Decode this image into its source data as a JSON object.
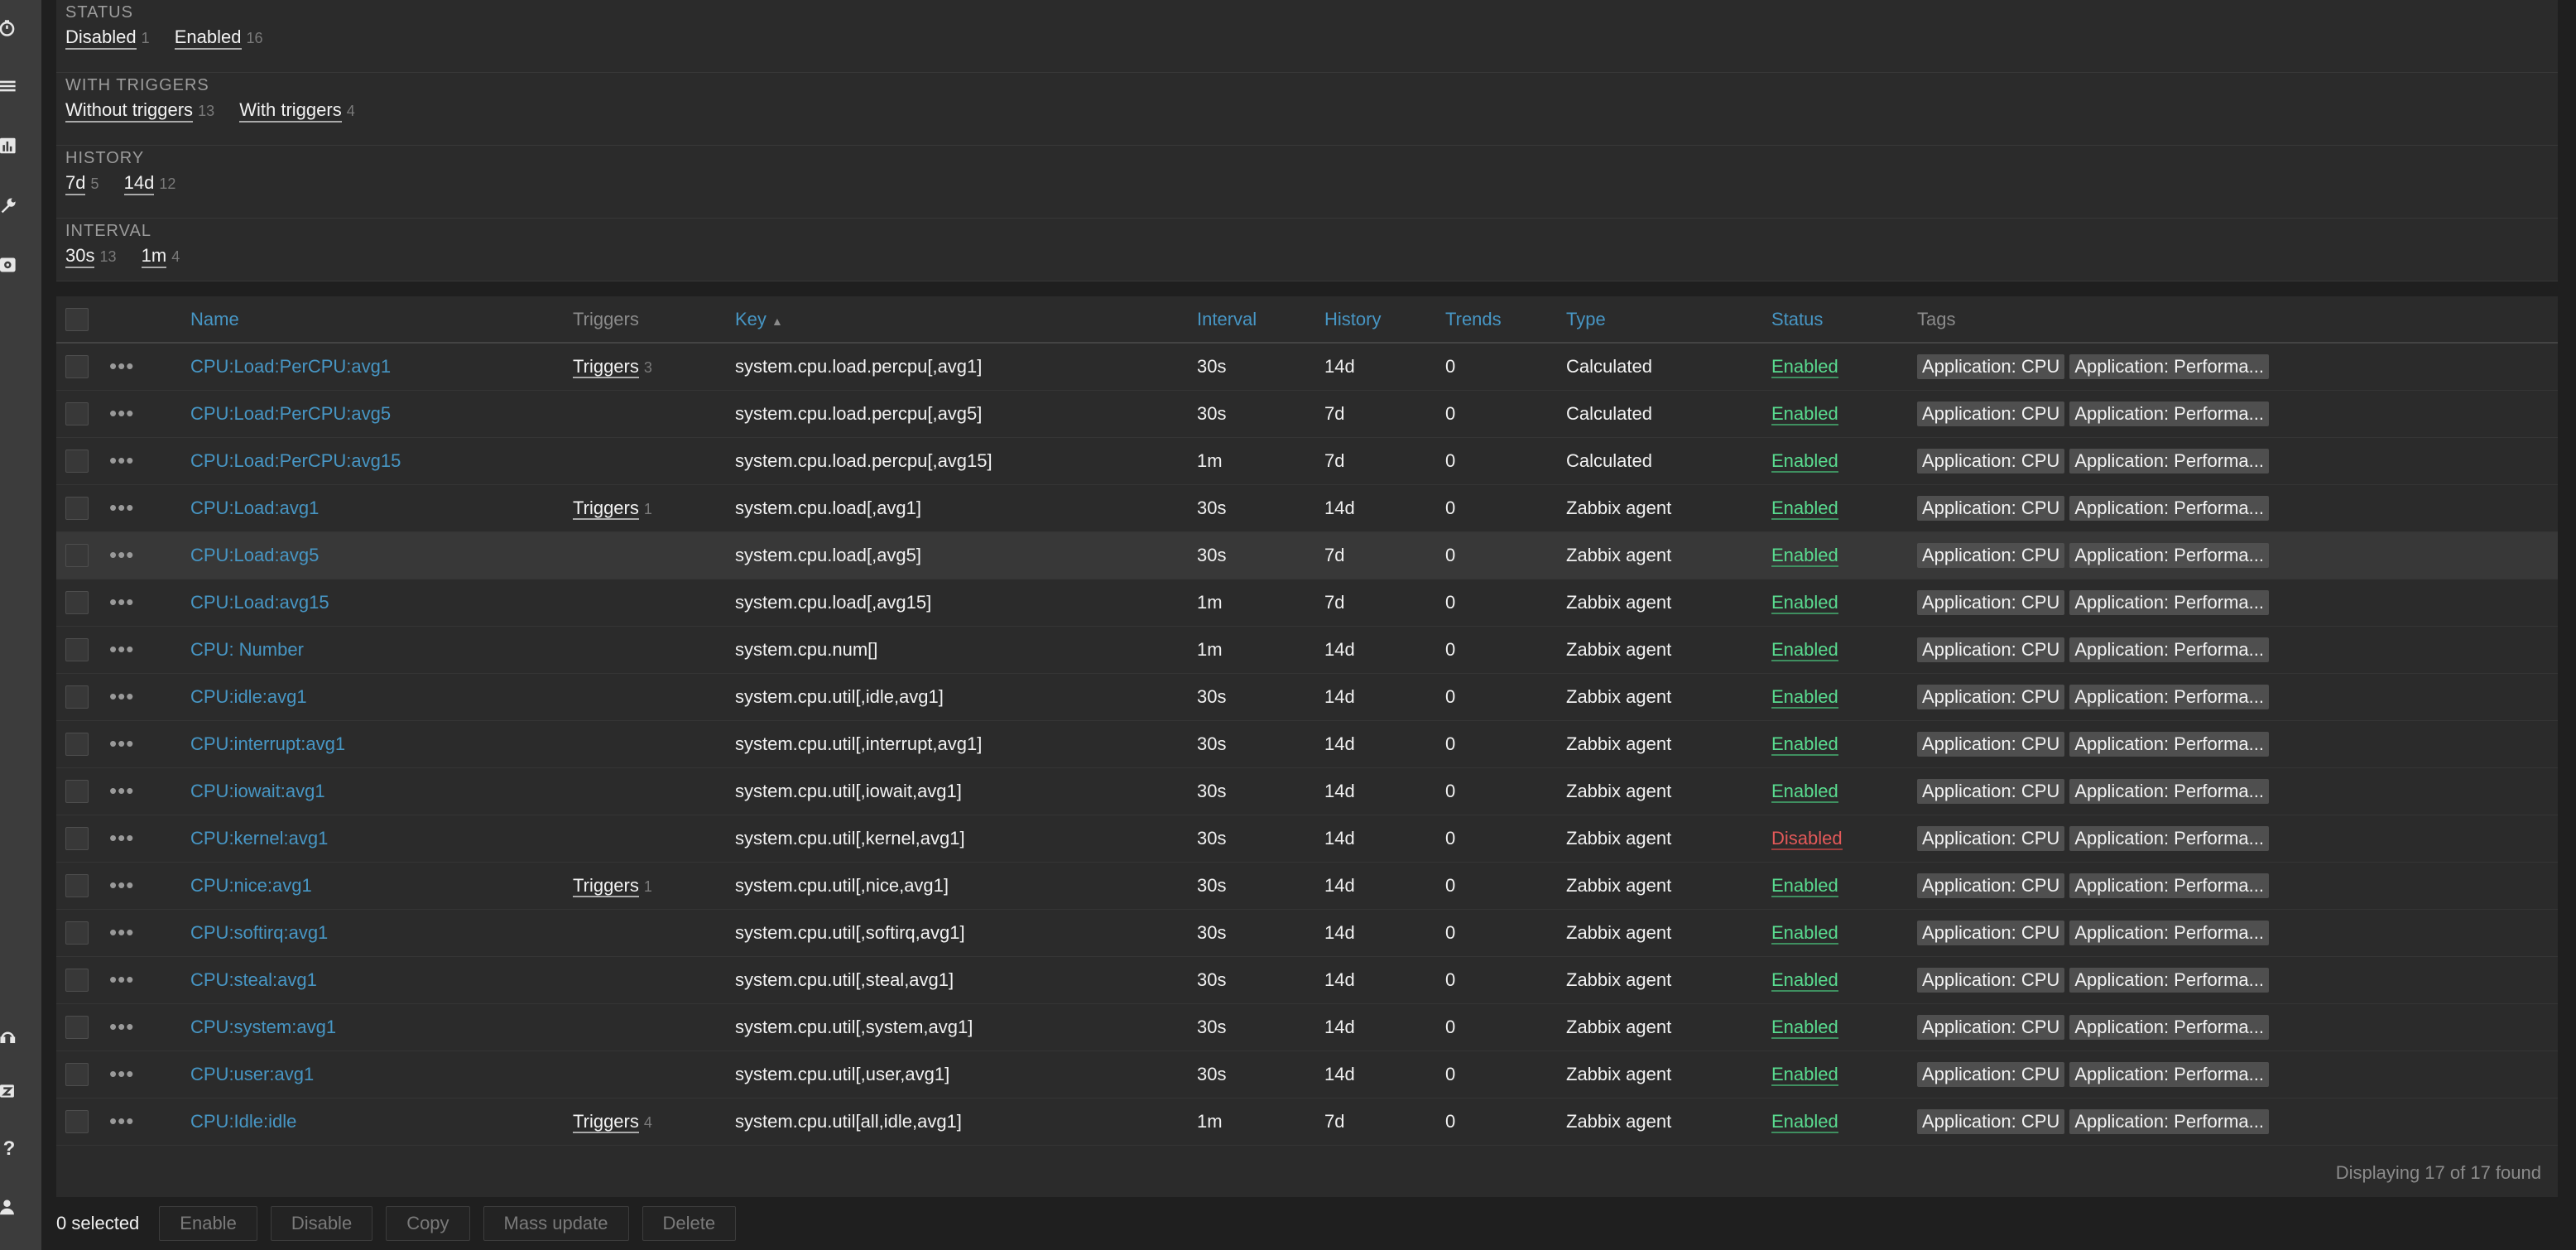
{
  "filter": {
    "groups": [
      {
        "heading": "STATUS",
        "values": [
          {
            "label": "Disabled",
            "count": "1"
          },
          {
            "label": "Enabled",
            "count": "16"
          }
        ]
      },
      {
        "heading": "WITH TRIGGERS",
        "values": [
          {
            "label": "Without triggers",
            "count": "13"
          },
          {
            "label": "With triggers",
            "count": "4"
          }
        ]
      },
      {
        "heading": "HISTORY",
        "values": [
          {
            "label": "7d",
            "count": "5"
          },
          {
            "label": "14d",
            "count": "12"
          }
        ]
      },
      {
        "heading": "INTERVAL",
        "values": [
          {
            "label": "30s",
            "count": "13"
          },
          {
            "label": "1m",
            "count": "4"
          }
        ]
      }
    ]
  },
  "table": {
    "columns": {
      "name": "Name",
      "triggers": "Triggers",
      "key": "Key",
      "key_sort_icon": "sort-ascending-icon",
      "interval": "Interval",
      "history": "History",
      "trends": "Trends",
      "type": "Type",
      "status": "Status",
      "tags": "Tags"
    },
    "rows": [
      {
        "name": "CPU:Load:PerCPU:avg1",
        "triggers": "Triggers",
        "trigger_count": "3",
        "key": "system.cpu.load.percpu[,avg1]",
        "interval": "30s",
        "history": "14d",
        "trends": "0",
        "type": "Calculated",
        "status": "Enabled",
        "tags": [
          "Application: CPU",
          "Application: Performa..."
        ]
      },
      {
        "name": "CPU:Load:PerCPU:avg5",
        "triggers": "",
        "trigger_count": "",
        "key": "system.cpu.load.percpu[,avg5]",
        "interval": "30s",
        "history": "7d",
        "trends": "0",
        "type": "Calculated",
        "status": "Enabled",
        "tags": [
          "Application: CPU",
          "Application: Performa..."
        ]
      },
      {
        "name": "CPU:Load:PerCPU:avg15",
        "triggers": "",
        "trigger_count": "",
        "key": "system.cpu.load.percpu[,avg15]",
        "interval": "1m",
        "history": "7d",
        "trends": "0",
        "type": "Calculated",
        "status": "Enabled",
        "tags": [
          "Application: CPU",
          "Application: Performa..."
        ]
      },
      {
        "name": "CPU:Load:avg1",
        "triggers": "Triggers",
        "trigger_count": "1",
        "key": "system.cpu.load[,avg1]",
        "interval": "30s",
        "history": "14d",
        "trends": "0",
        "type": "Zabbix agent",
        "status": "Enabled",
        "tags": [
          "Application: CPU",
          "Application: Performa..."
        ]
      },
      {
        "name": "CPU:Load:avg5",
        "triggers": "",
        "trigger_count": "",
        "key": "system.cpu.load[,avg5]",
        "interval": "30s",
        "history": "7d",
        "trends": "0",
        "type": "Zabbix agent",
        "status": "Enabled",
        "tags": [
          "Application: CPU",
          "Application: Performa..."
        ]
      },
      {
        "name": "CPU:Load:avg15",
        "triggers": "",
        "trigger_count": "",
        "key": "system.cpu.load[,avg15]",
        "interval": "1m",
        "history": "7d",
        "trends": "0",
        "type": "Zabbix agent",
        "status": "Enabled",
        "tags": [
          "Application: CPU",
          "Application: Performa..."
        ]
      },
      {
        "name": "CPU: Number",
        "triggers": "",
        "trigger_count": "",
        "key": "system.cpu.num[]",
        "interval": "1m",
        "history": "14d",
        "trends": "0",
        "type": "Zabbix agent",
        "status": "Enabled",
        "tags": [
          "Application: CPU",
          "Application: Performa..."
        ]
      },
      {
        "name": "CPU:idle:avg1",
        "triggers": "",
        "trigger_count": "",
        "key": "system.cpu.util[,idle,avg1]",
        "interval": "30s",
        "history": "14d",
        "trends": "0",
        "type": "Zabbix agent",
        "status": "Enabled",
        "tags": [
          "Application: CPU",
          "Application: Performa..."
        ]
      },
      {
        "name": "CPU:interrupt:avg1",
        "triggers": "",
        "trigger_count": "",
        "key": "system.cpu.util[,interrupt,avg1]",
        "interval": "30s",
        "history": "14d",
        "trends": "0",
        "type": "Zabbix agent",
        "status": "Enabled",
        "tags": [
          "Application: CPU",
          "Application: Performa..."
        ]
      },
      {
        "name": "CPU:iowait:avg1",
        "triggers": "",
        "trigger_count": "",
        "key": "system.cpu.util[,iowait,avg1]",
        "interval": "30s",
        "history": "14d",
        "trends": "0",
        "type": "Zabbix agent",
        "status": "Enabled",
        "tags": [
          "Application: CPU",
          "Application: Performa..."
        ]
      },
      {
        "name": "CPU:kernel:avg1",
        "triggers": "",
        "trigger_count": "",
        "key": "system.cpu.util[,kernel,avg1]",
        "interval": "30s",
        "history": "14d",
        "trends": "0",
        "type": "Zabbix agent",
        "status": "Disabled",
        "tags": [
          "Application: CPU",
          "Application: Performa..."
        ]
      },
      {
        "name": "CPU:nice:avg1",
        "triggers": "Triggers",
        "trigger_count": "1",
        "key": "system.cpu.util[,nice,avg1]",
        "interval": "30s",
        "history": "14d",
        "trends": "0",
        "type": "Zabbix agent",
        "status": "Enabled",
        "tags": [
          "Application: CPU",
          "Application: Performa..."
        ]
      },
      {
        "name": "CPU:softirq:avg1",
        "triggers": "",
        "trigger_count": "",
        "key": "system.cpu.util[,softirq,avg1]",
        "interval": "30s",
        "history": "14d",
        "trends": "0",
        "type": "Zabbix agent",
        "status": "Enabled",
        "tags": [
          "Application: CPU",
          "Application: Performa..."
        ]
      },
      {
        "name": "CPU:steal:avg1",
        "triggers": "",
        "trigger_count": "",
        "key": "system.cpu.util[,steal,avg1]",
        "interval": "30s",
        "history": "14d",
        "trends": "0",
        "type": "Zabbix agent",
        "status": "Enabled",
        "tags": [
          "Application: CPU",
          "Application: Performa..."
        ]
      },
      {
        "name": "CPU:system:avg1",
        "triggers": "",
        "trigger_count": "",
        "key": "system.cpu.util[,system,avg1]",
        "interval": "30s",
        "history": "14d",
        "trends": "0",
        "type": "Zabbix agent",
        "status": "Enabled",
        "tags": [
          "Application: CPU",
          "Application: Performa..."
        ]
      },
      {
        "name": "CPU:user:avg1",
        "triggers": "",
        "trigger_count": "",
        "key": "system.cpu.util[,user,avg1]",
        "interval": "30s",
        "history": "14d",
        "trends": "0",
        "type": "Zabbix agent",
        "status": "Enabled",
        "tags": [
          "Application: CPU",
          "Application: Performa..."
        ]
      },
      {
        "name": "CPU:Idle:idle",
        "triggers": "Triggers",
        "trigger_count": "4",
        "key": "system.cpu.util[all,idle,avg1]",
        "interval": "1m",
        "history": "7d",
        "trends": "0",
        "type": "Zabbix agent",
        "status": "Enabled",
        "tags": [
          "Application: CPU",
          "Application: Performa..."
        ]
      }
    ],
    "displaying": "Displaying 17 of 17 found"
  },
  "actions": {
    "selected": "0 selected",
    "buttons": [
      "Enable",
      "Disable",
      "Copy",
      "Mass update",
      "Delete"
    ]
  },
  "sidebar": {
    "icons": [
      "stopwatch-icon",
      "list-icon",
      "chart-icon",
      "wrench-icon",
      "gear-icon",
      "support-icon",
      "zabbix-share-icon",
      "help-icon",
      "user-icon"
    ]
  },
  "colors": {
    "link": "#4796c4",
    "enabled": "#59db8f",
    "disabled": "#e45959",
    "panel": "#2b2b2b",
    "sidebar": "#3c3c3c"
  }
}
